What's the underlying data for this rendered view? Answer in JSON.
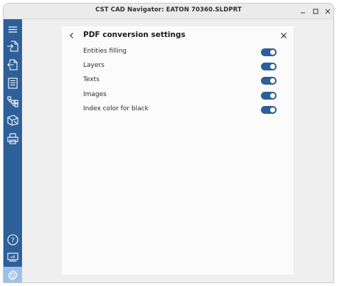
{
  "window": {
    "title": "CST CAD Navigator: EATON 70360.SLDPRT"
  },
  "window_controls": [
    "minimize-icon",
    "maximize-icon",
    "close-icon"
  ],
  "sidebar": {
    "items": [
      {
        "icon": "menu-icon"
      },
      {
        "icon": "open-file-icon"
      },
      {
        "icon": "export-file-icon"
      },
      {
        "icon": "document-properties-icon"
      },
      {
        "icon": "structure-tree-icon"
      },
      {
        "icon": "convert-icon"
      },
      {
        "icon": "print-icon"
      }
    ],
    "bottom_items": [
      {
        "icon": "help-icon"
      },
      {
        "icon": "version-info-icon"
      },
      {
        "icon": "settings-icon",
        "active": true
      }
    ]
  },
  "panel": {
    "title": "PDF conversion settings",
    "settings": [
      {
        "label": "Entities filling",
        "enabled": true
      },
      {
        "label": "Layers",
        "enabled": true
      },
      {
        "label": "Texts",
        "enabled": true
      },
      {
        "label": "Images",
        "enabled": true
      },
      {
        "label": "Index color for black",
        "enabled": true
      }
    ]
  },
  "colors": {
    "accent": "#2d5f99",
    "active_item": "#9dc1e6",
    "panel_bg": "#fbfbfb",
    "window_bg": "#efefef"
  }
}
